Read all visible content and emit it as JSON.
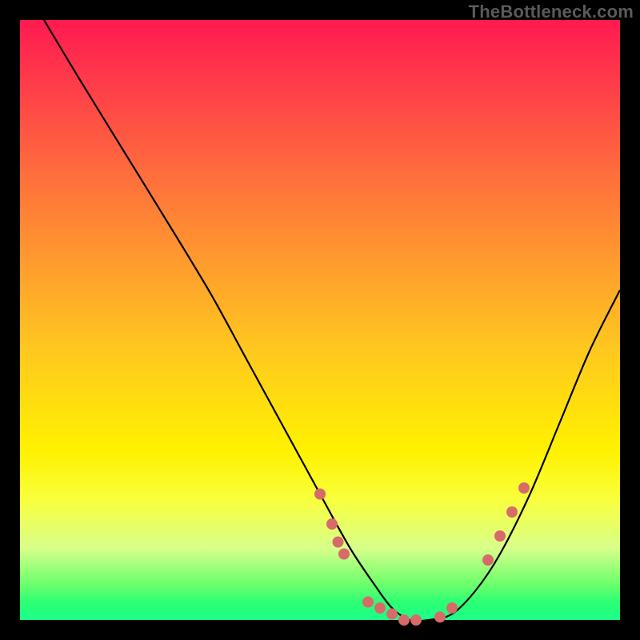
{
  "watermark": "TheBottleneck.com",
  "chart_data": {
    "type": "line",
    "title": "",
    "xlabel": "",
    "ylabel": "",
    "xlim": [
      0,
      100
    ],
    "ylim": [
      0,
      100
    ],
    "grid": false,
    "legend": false,
    "background": "red-yellow-green vertical gradient",
    "series": [
      {
        "name": "curve",
        "x": [
          4,
          10,
          18,
          26,
          32,
          38,
          44,
          50,
          55,
          59,
          62,
          65,
          68,
          72,
          76,
          80,
          85,
          90,
          95,
          100
        ],
        "y": [
          100,
          90,
          77,
          64,
          54,
          43,
          32,
          21,
          12,
          6,
          2,
          0,
          0,
          1,
          5,
          11,
          21,
          33,
          45,
          55
        ]
      }
    ],
    "markers": [
      {
        "x": 50,
        "y": 21
      },
      {
        "x": 52,
        "y": 16
      },
      {
        "x": 53,
        "y": 13
      },
      {
        "x": 54,
        "y": 11
      },
      {
        "x": 58,
        "y": 3
      },
      {
        "x": 60,
        "y": 2
      },
      {
        "x": 62,
        "y": 1
      },
      {
        "x": 64,
        "y": 0
      },
      {
        "x": 66,
        "y": 0
      },
      {
        "x": 70,
        "y": 0.5
      },
      {
        "x": 72,
        "y": 2
      },
      {
        "x": 78,
        "y": 10
      },
      {
        "x": 80,
        "y": 14
      },
      {
        "x": 82,
        "y": 18
      },
      {
        "x": 84,
        "y": 22
      }
    ]
  }
}
